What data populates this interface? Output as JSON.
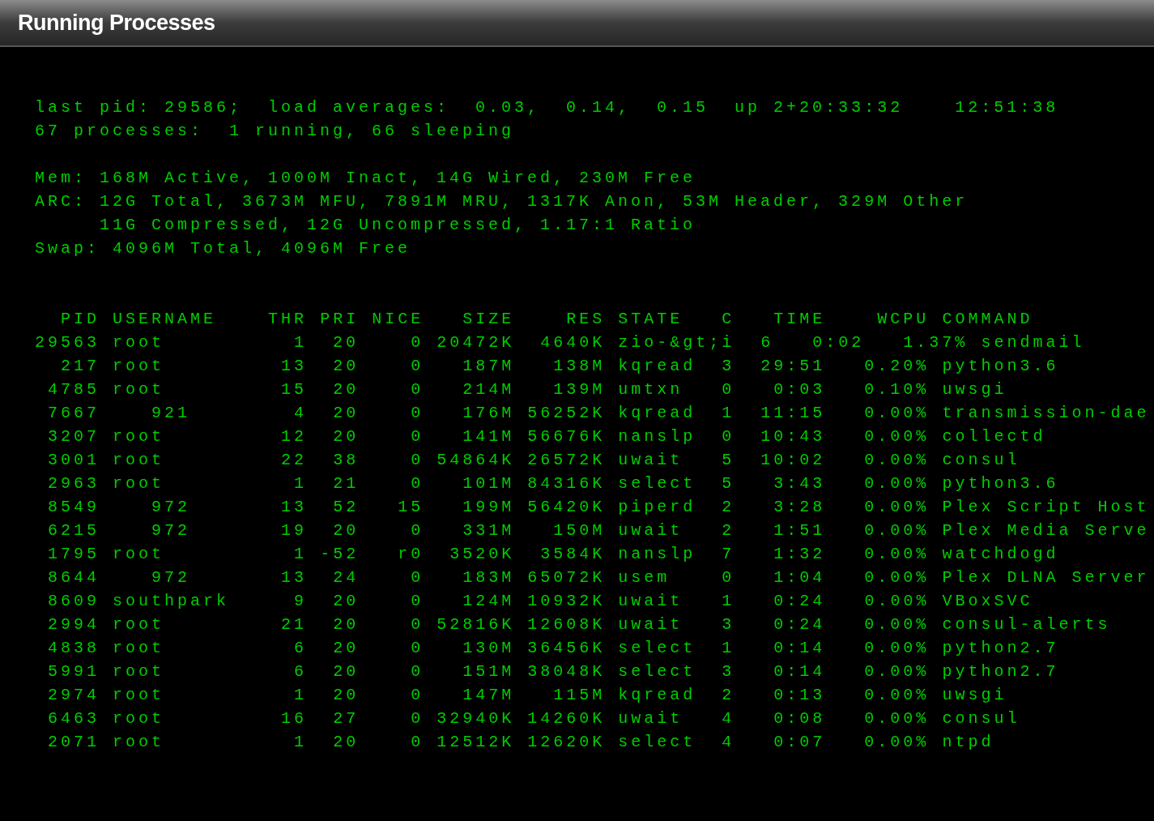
{
  "window": {
    "title": "Running Processes"
  },
  "summary_lines": [
    "last pid: 29586;  load averages:  0.03,  0.14,  0.15  up 2+20:33:32    12:51:38",
    "67 processes:  1 running, 66 sleeping"
  ],
  "memory_lines": [
    {
      "kind": "line",
      "text": "Mem: 168M Active, 1000M Inact, 14G Wired, 230M Free"
    },
    {
      "kind": "line",
      "text": "ARC: 12G Total, 3673M MFU, 7891M MRU, 1317K Anon, 53M Header, 329M Other"
    },
    {
      "kind": "continuation",
      "text": "11G Compressed, 12G Uncompressed, 1.17:1 Ratio"
    },
    {
      "kind": "line",
      "text": "Swap: 4096M Total, 4096M Free"
    }
  ],
  "table": {
    "columns": [
      "PID",
      "USERNAME",
      "THR",
      "PRI",
      "NICE",
      "SIZE",
      "RES",
      "STATE",
      "C",
      "TIME",
      "WCPU",
      "COMMAND"
    ],
    "rows": [
      [
        "29563",
        "root",
        "1",
        "20",
        "0",
        "20472K",
        "4640K",
        "zio-&gt;i",
        "6",
        "0:02",
        "1.37%",
        "sendmail"
      ],
      [
        "217",
        "root",
        "13",
        "20",
        "0",
        "187M",
        "138M",
        "kqread",
        "3",
        "29:51",
        "0.20%",
        "python3.6"
      ],
      [
        "4785",
        "root",
        "15",
        "20",
        "0",
        "214M",
        "139M",
        "umtxn",
        "0",
        "0:03",
        "0.10%",
        "uwsgi"
      ],
      [
        "7667",
        "921",
        "4",
        "20",
        "0",
        "176M",
        "56252K",
        "kqread",
        "1",
        "11:15",
        "0.00%",
        "transmission-dae"
      ],
      [
        "3207",
        "root",
        "12",
        "20",
        "0",
        "141M",
        "56676K",
        "nanslp",
        "0",
        "10:43",
        "0.00%",
        "collectd"
      ],
      [
        "3001",
        "root",
        "22",
        "38",
        "0",
        "54864K",
        "26572K",
        "uwait",
        "5",
        "10:02",
        "0.00%",
        "consul"
      ],
      [
        "2963",
        "root",
        "1",
        "21",
        "0",
        "101M",
        "84316K",
        "select",
        "5",
        "3:43",
        "0.00%",
        "python3.6"
      ],
      [
        "8549",
        "972",
        "13",
        "52",
        "15",
        "199M",
        "56420K",
        "piperd",
        "2",
        "3:28",
        "0.00%",
        "Plex Script Host"
      ],
      [
        "6215",
        "972",
        "19",
        "20",
        "0",
        "331M",
        "150M",
        "uwait",
        "2",
        "1:51",
        "0.00%",
        "Plex Media Serve"
      ],
      [
        "1795",
        "root",
        "1",
        "-52",
        "r0",
        "3520K",
        "3584K",
        "nanslp",
        "7",
        "1:32",
        "0.00%",
        "watchdogd"
      ],
      [
        "8644",
        "972",
        "13",
        "24",
        "0",
        "183M",
        "65072K",
        "usem",
        "0",
        "1:04",
        "0.00%",
        "Plex DLNA Server"
      ],
      [
        "8609",
        "southpark",
        "9",
        "20",
        "0",
        "124M",
        "10932K",
        "uwait",
        "1",
        "0:24",
        "0.00%",
        "VBoxSVC"
      ],
      [
        "2994",
        "root",
        "21",
        "20",
        "0",
        "52816K",
        "12608K",
        "uwait",
        "3",
        "0:24",
        "0.00%",
        "consul-alerts"
      ],
      [
        "4838",
        "root",
        "6",
        "20",
        "0",
        "130M",
        "36456K",
        "select",
        "1",
        "0:14",
        "0.00%",
        "python2.7"
      ],
      [
        "5991",
        "root",
        "6",
        "20",
        "0",
        "151M",
        "38048K",
        "select",
        "3",
        "0:14",
        "0.00%",
        "python2.7"
      ],
      [
        "2974",
        "root",
        "1",
        "20",
        "0",
        "147M",
        "115M",
        "kqread",
        "2",
        "0:13",
        "0.00%",
        "uwsgi"
      ],
      [
        "6463",
        "root",
        "16",
        "27",
        "0",
        "32940K",
        "14260K",
        "uwait",
        "4",
        "0:08",
        "0.00%",
        "consul"
      ],
      [
        "2071",
        "root",
        "1",
        "20",
        "0",
        "12512K",
        "12620K",
        "select",
        "4",
        "0:07",
        "0.00%",
        "ntpd"
      ]
    ]
  }
}
